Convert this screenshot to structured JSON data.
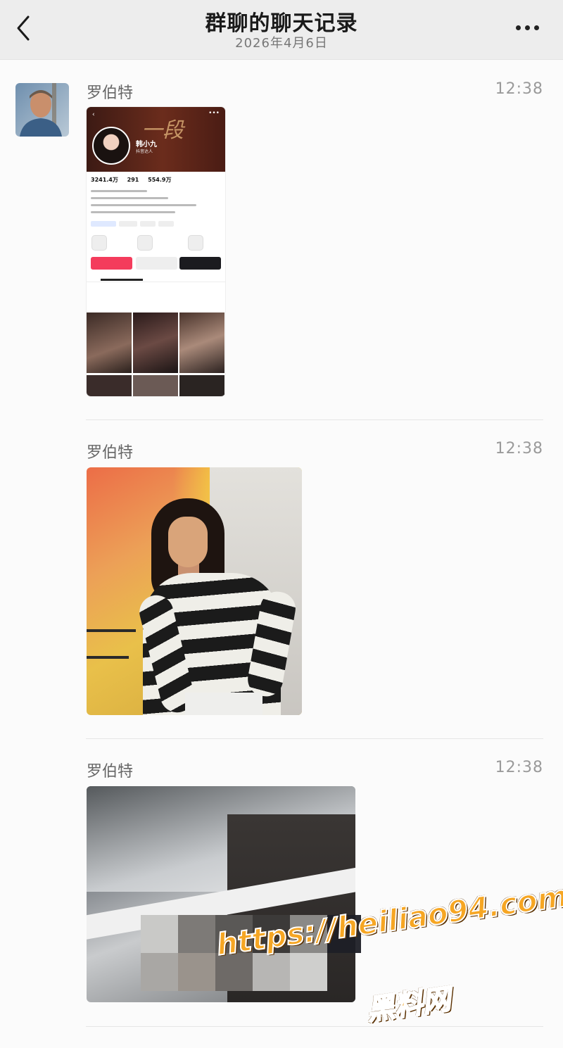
{
  "header": {
    "title": "群聊的聊天记录",
    "date": "2026年4月6日",
    "back_icon": "chevron-left-icon",
    "more_icon": "ellipsis-icon"
  },
  "messages": [
    {
      "sender": "罗伯特",
      "time": "12:38",
      "type": "image"
    },
    {
      "sender": "罗伯特",
      "time": "12:38",
      "type": "image"
    },
    {
      "sender": "罗伯特",
      "time": "12:38",
      "type": "image"
    }
  ],
  "embedded_profile": {
    "banner_text": "一段",
    "name": "韩小九",
    "tag": "抖音达人",
    "stats": [
      "3241.4万",
      "291",
      "554.9万"
    ]
  },
  "watermark": {
    "url": "https://heiliao94.com",
    "label": "黑料网",
    "color": "#f6a623"
  }
}
